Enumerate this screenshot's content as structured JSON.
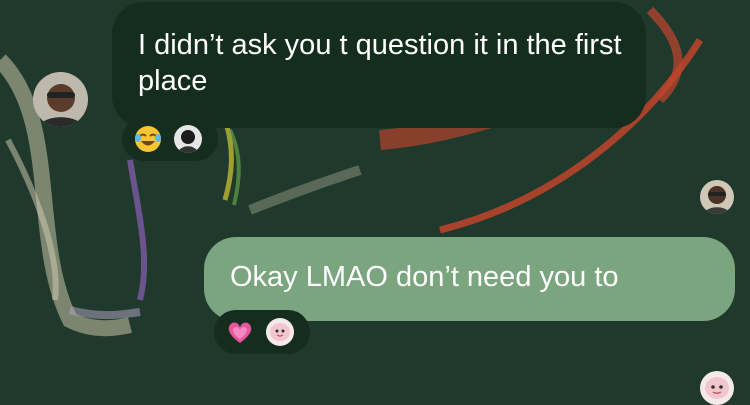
{
  "conversation": {
    "messages": [
      {
        "direction": "incoming",
        "text": "I didn’t ask you t question it in the first place",
        "reaction": {
          "emoji": "face-with-tears-of-joy-icon"
        }
      },
      {
        "direction": "outgoing",
        "text": "Okay LMAO don’t need you to",
        "reaction": {
          "emoji": "growing-heart-icon"
        }
      }
    ]
  },
  "colors": {
    "wallpaper": "#1f3a2c",
    "incoming_bubble": "#142d1f",
    "outgoing_bubble": "#7aa57f",
    "text": "#ffffff"
  }
}
